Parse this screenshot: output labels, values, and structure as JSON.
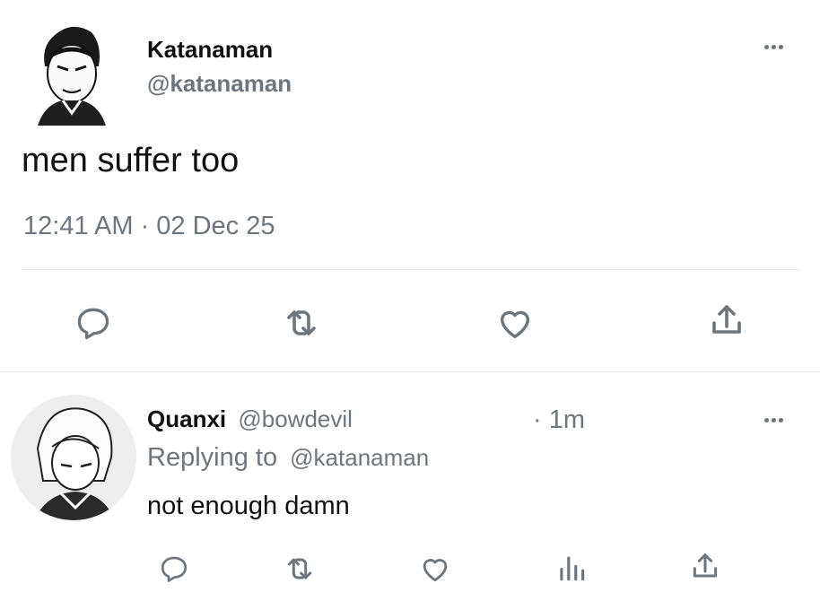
{
  "main_tweet": {
    "display_name": "Katanaman",
    "handle": "@katanaman",
    "text": "men suffer too",
    "timestamp": "12:41 AM · 02 Dec 25",
    "avatar_icon": "manga-man-avatar",
    "actions": [
      "reply-icon",
      "retweet-icon",
      "like-icon",
      "share-icon"
    ]
  },
  "reply_tweet": {
    "display_name": "Quanxi",
    "handle": "@bowdevil",
    "time_ago": "· 1m",
    "replying_prefix": "Replying to",
    "replying_handle": "@katanaman",
    "text": "not enough damn",
    "avatar_icon": "manga-woman-avatar",
    "actions": [
      "reply-icon",
      "retweet-icon",
      "like-icon",
      "views-icon",
      "share-icon"
    ]
  },
  "colors": {
    "text": "#0f1419",
    "muted": "#6e767d",
    "accent_link": "#1d9bf0",
    "divider": "#e4e8eb"
  }
}
